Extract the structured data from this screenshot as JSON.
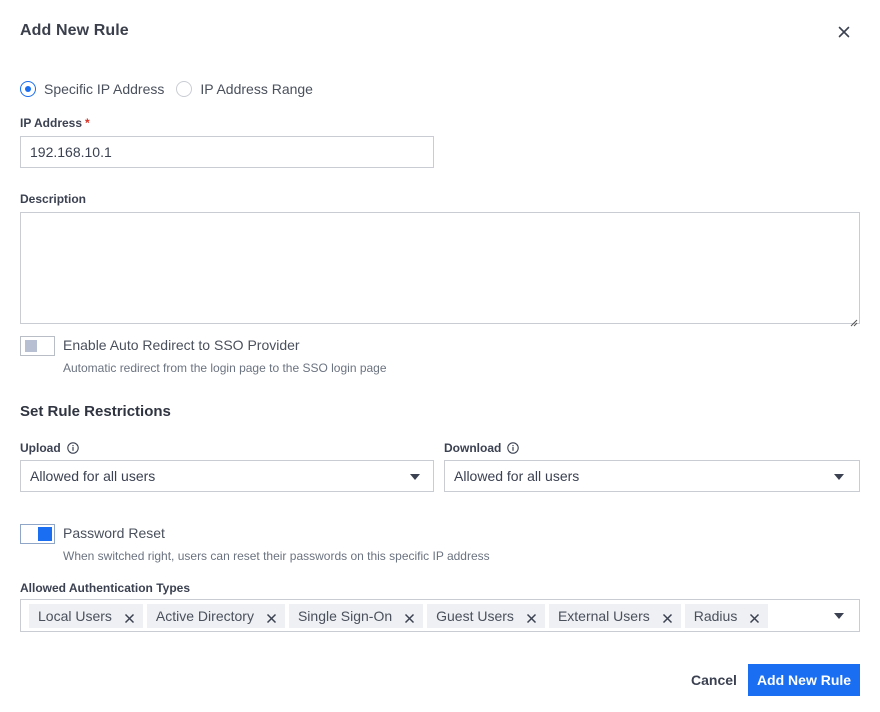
{
  "dialog": {
    "title": "Add New Rule",
    "close_icon": "close-icon"
  },
  "ip_mode": {
    "options": [
      {
        "label": "Specific IP Address",
        "checked": true
      },
      {
        "label": "IP Address Range",
        "checked": false
      }
    ]
  },
  "ip_address": {
    "label": "IP Address",
    "required_mark": "*",
    "value": "192.168.10.1"
  },
  "description": {
    "label": "Description",
    "value": ""
  },
  "auto_redirect": {
    "label": "Enable Auto Redirect to SSO Provider",
    "helper": "Automatic redirect from the login page to the SSO login page",
    "enabled": false
  },
  "restrictions": {
    "title": "Set Rule Restrictions",
    "upload": {
      "label": "Upload",
      "value": "Allowed for all users",
      "icon": "info-icon"
    },
    "download": {
      "label": "Download",
      "value": "Allowed for all users",
      "icon": "info-icon"
    }
  },
  "password_reset": {
    "label": "Password Reset",
    "helper": "When switched right, users can reset their passwords on this specific IP address",
    "enabled": true
  },
  "auth_types": {
    "label": "Allowed Authentication Types",
    "selected": [
      "Local Users",
      "Active Directory",
      "Single Sign-On",
      "Guest Users",
      "External Users",
      "Radius"
    ]
  },
  "actions": {
    "cancel": "Cancel",
    "submit": "Add New Rule"
  },
  "colors": {
    "primary": "#1a6ef2",
    "required": "#d93025",
    "chip_bg": "#eef0f3",
    "border": "#c9cdd3"
  }
}
